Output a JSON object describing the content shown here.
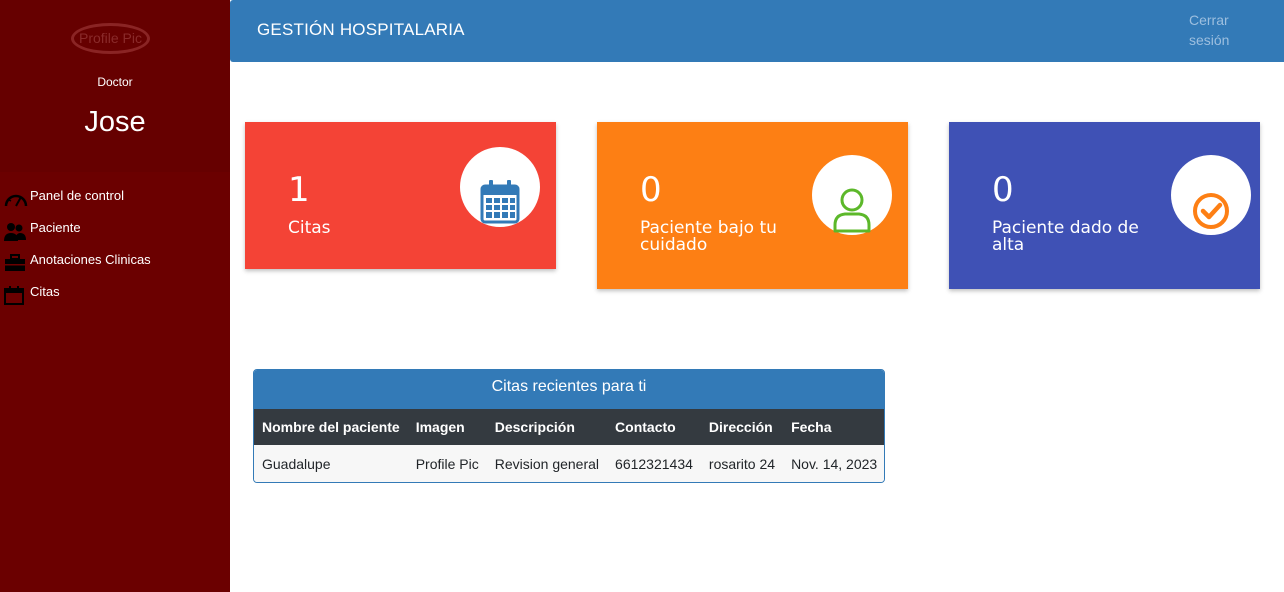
{
  "profile": {
    "avatar_alt": "Profile Pic",
    "role": "Doctor",
    "name": "Jose"
  },
  "nav": [
    {
      "label": "Panel de control",
      "icon": "dashboard-gauge-icon"
    },
    {
      "label": "Paciente",
      "icon": "users-icon"
    },
    {
      "label": "Anotaciones Clinicas",
      "icon": "briefcase-icon"
    },
    {
      "label": "Citas",
      "icon": "calendar-icon"
    }
  ],
  "header": {
    "title": "GESTIÓN HOSPITALARIA",
    "logout_line1": "Cerrar",
    "logout_line2": "sesión"
  },
  "cards": [
    {
      "count": "1",
      "label": "Citas",
      "color": "#f44336",
      "icon": "calendar-icon"
    },
    {
      "count": "0",
      "label": "Paciente bajo tu cuidado",
      "color": "#fd7f14",
      "icon": "user-icon"
    },
    {
      "count": "0",
      "label": "Paciente dado de alta",
      "color": "#3f51b5",
      "icon": "check-circle-icon"
    }
  ],
  "recent": {
    "title": "Citas recientes para ti",
    "columns": [
      "Nombre del paciente",
      "Imagen",
      "Descripción",
      "Contacto",
      "Dirección",
      "Fecha"
    ],
    "rows": [
      [
        "Guadalupe",
        "Profile Pic",
        "Revision general",
        "6612321434",
        "rosarito 24",
        "Nov. 14, 2023"
      ]
    ]
  },
  "colors": {
    "sidebar": "#6b0000",
    "header": "#337ab7",
    "table_head": "#343a40"
  }
}
